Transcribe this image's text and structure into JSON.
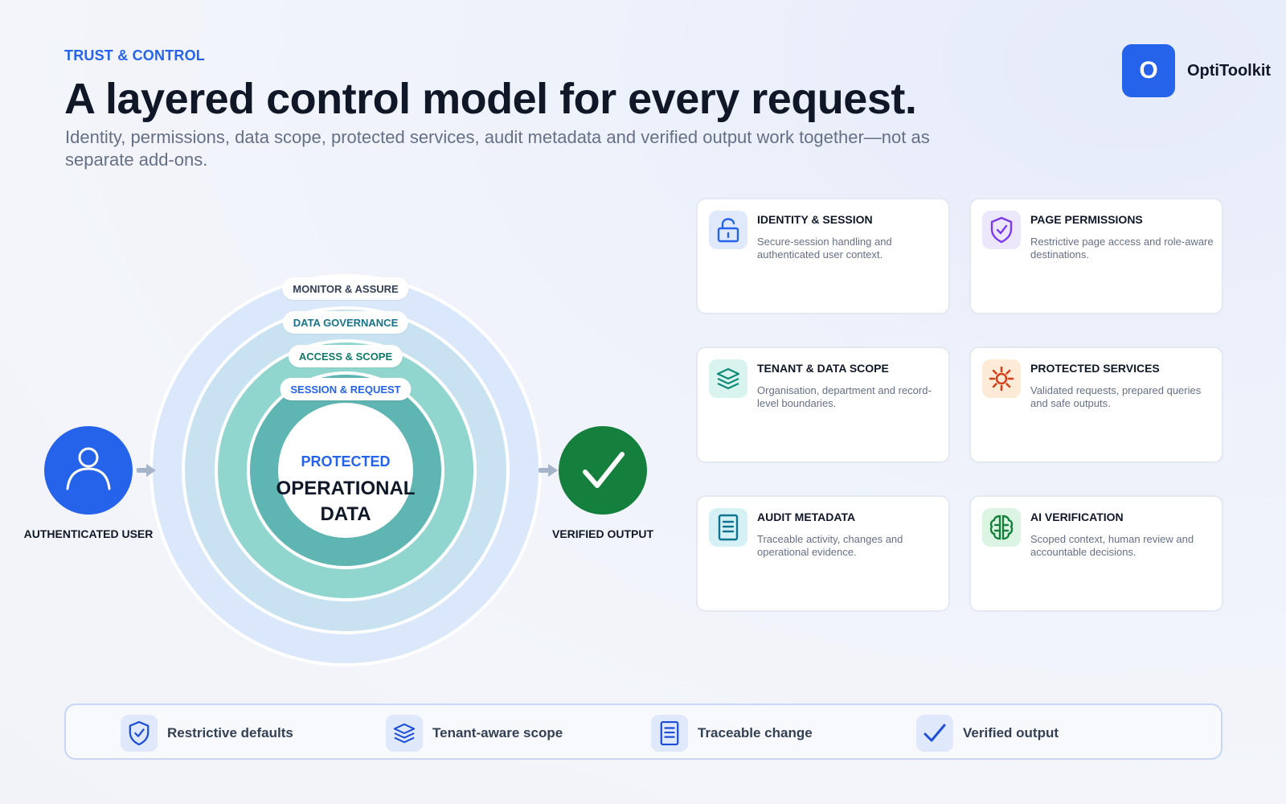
{
  "header": {
    "eyebrow": "TRUST & CONTROL",
    "title": "A layered control model for every request.",
    "subtitle": "Identity, permissions, data scope, protected services, audit metadata and verified output work together—not as separate add-ons."
  },
  "brand": {
    "mark": "O",
    "name": "OptiToolkit"
  },
  "diagram": {
    "rings": [
      {
        "label": "MONITOR & ASSURE",
        "fill": "#dbe8fb",
        "text_color": "#344054"
      },
      {
        "label": "DATA GOVERNANCE",
        "fill": "#c8e2f2",
        "text_color": "#17738a"
      },
      {
        "label": "ACCESS & SCOPE",
        "fill": "#90d6cf",
        "text_color": "#0f7a66"
      },
      {
        "label": "SESSION & REQUEST",
        "fill": "#5fb5b1",
        "text_color": "#2563eb"
      }
    ],
    "core_eyebrow": "PROTECTED",
    "core_title": "OPERATIONAL DATA",
    "input_node": {
      "label": "AUTHENTICATED USER",
      "color": "#2563eb",
      "icon": "user-icon"
    },
    "output_node": {
      "label": "VERIFIED OUTPUT",
      "color": "#15803d",
      "icon": "check-icon"
    }
  },
  "cards": [
    {
      "title": "IDENTITY & SESSION",
      "desc": "Secure-session handling and authenticated user context.",
      "icon": "lock-icon",
      "color": "#2563eb",
      "bg": "#dfe9fb"
    },
    {
      "title": "PAGE PERMISSIONS",
      "desc": "Restrictive page access and role-aware destinations.",
      "icon": "shield-check-icon",
      "color": "#7c3aed",
      "bg": "#ede7fc"
    },
    {
      "title": "TENANT & DATA SCOPE",
      "desc": "Organisation, department and record-level boundaries.",
      "icon": "layers-icon",
      "color": "#0f8a78",
      "bg": "#d9f4ee"
    },
    {
      "title": "PROTECTED SERVICES",
      "desc": "Validated requests, prepared queries and safe outputs.",
      "icon": "gear-icon",
      "color": "#d4421b",
      "bg": "#fdebd8"
    },
    {
      "title": "AUDIT METADATA",
      "desc": "Traceable activity, changes and operational evidence.",
      "icon": "document-icon",
      "color": "#0e7490",
      "bg": "#d6f1f5"
    },
    {
      "title": "AI VERIFICATION",
      "desc": "Scoped context, human review and accountable decisions.",
      "icon": "brain-icon",
      "color": "#15803d",
      "bg": "#dcf5e2"
    }
  ],
  "strip": [
    {
      "label": "Restrictive defaults",
      "icon": "shield-check-icon"
    },
    {
      "label": "Tenant-aware scope",
      "icon": "layers-icon"
    },
    {
      "label": "Traceable change",
      "icon": "document-icon"
    },
    {
      "label": "Verified output",
      "icon": "check-icon"
    }
  ],
  "colors": {
    "accent": "#2563eb",
    "heading": "#101828",
    "muted": "#667085"
  }
}
